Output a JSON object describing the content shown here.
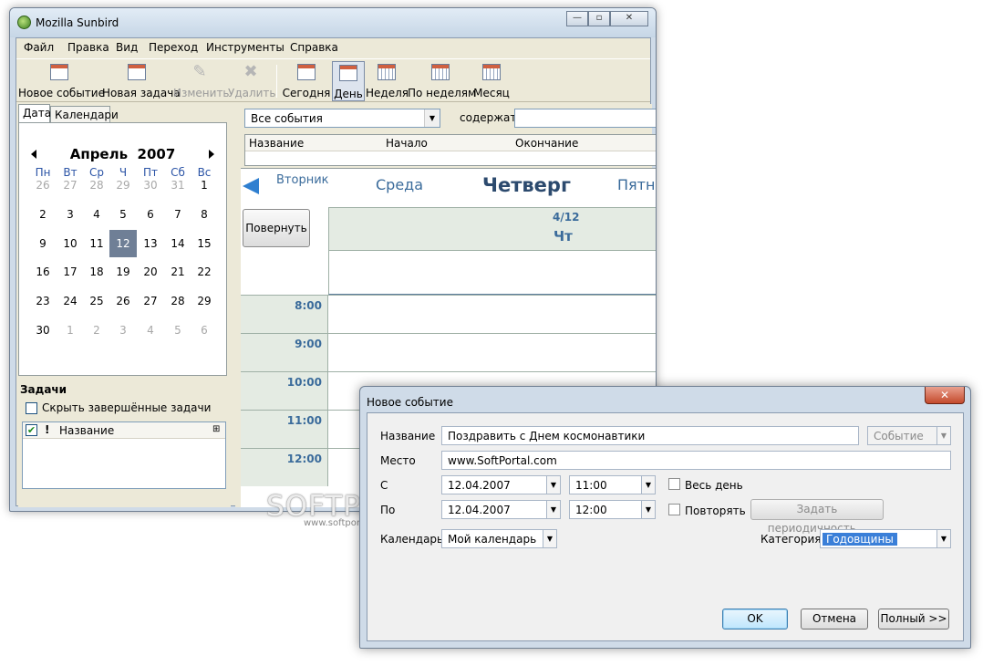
{
  "app": {
    "title": "Mozilla Sunbird"
  },
  "menu": [
    "Файл",
    "Правка",
    "Вид",
    "Переход",
    "Инструменты",
    "Справка"
  ],
  "toolbar": {
    "new_event": "Новое событие",
    "new_task": "Новая задача",
    "edit": "Изменить",
    "delete": "Удалить",
    "today": "Сегодня",
    "day": "День",
    "week": "Неделя",
    "multiweek": "По неделям",
    "month": "Месяц"
  },
  "left": {
    "tabs": [
      "Дата",
      "Календари"
    ],
    "minical": {
      "month": "Апрель",
      "year": "2007",
      "weekdays": [
        "Пн",
        "Вт",
        "Ср",
        "Ч",
        "Пт",
        "Сб",
        "Вс"
      ],
      "weeks": [
        [
          "26",
          "27",
          "28",
          "29",
          "30",
          "31",
          "1"
        ],
        [
          "2",
          "3",
          "4",
          "5",
          "6",
          "7",
          "8"
        ],
        [
          "9",
          "10",
          "11",
          "12",
          "13",
          "14",
          "15"
        ],
        [
          "16",
          "17",
          "18",
          "19",
          "20",
          "21",
          "22"
        ],
        [
          "23",
          "24",
          "25",
          "26",
          "27",
          "28",
          "29"
        ],
        [
          "30",
          "1",
          "2",
          "3",
          "4",
          "5",
          "6"
        ]
      ],
      "selected": "12"
    },
    "tasks": {
      "title": "Задачи",
      "hide_completed": "Скрыть завершённые задачи",
      "col_priority": "!",
      "col_name": "Название"
    }
  },
  "filter": {
    "selected": "Все события",
    "contains_label": "содержат"
  },
  "eventlist": {
    "columns": [
      "Название",
      "Начало",
      "Окончание"
    ]
  },
  "dayview": {
    "prev_day": "Вторник",
    "day_left": "Среда",
    "day_current": "Четверг",
    "day_right": "Пятн",
    "rotate": "Повернуть",
    "date": "4/12",
    "weekday_short": "Чт",
    "hours": [
      "8:00",
      "9:00",
      "10:00",
      "11:00",
      "12:00"
    ]
  },
  "watermark": {
    "brand": "SOFTPORTAL",
    "url": "www.softportal.com"
  },
  "dialog": {
    "title": "Новое событие",
    "close": "✕",
    "name_label": "Название",
    "name_value": "Поздравить с Днем космонавтики",
    "type_value": "Событие",
    "location_label": "Место",
    "location_value": "www.SoftPortal.com",
    "from_label": "С",
    "from_date": "12.04.2007",
    "from_time": "11:00",
    "allday_label": "Весь день",
    "to_label": "По",
    "to_date": "12.04.2007",
    "to_time": "12:00",
    "repeat_label": "Повторять",
    "recurrence_button": "Задать периодичность...",
    "calendar_label": "Календарь",
    "calendar_value": "Мой календарь",
    "category_label": "Категория",
    "category_value": "Годовщины",
    "ok": "OK",
    "cancel": "Отмена",
    "full": "Полный >>"
  }
}
